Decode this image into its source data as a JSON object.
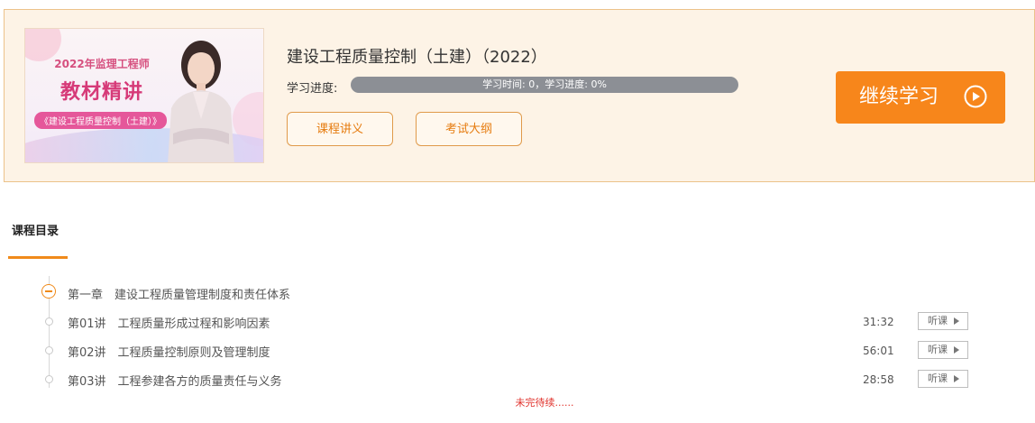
{
  "course": {
    "title": "建设工程质量控制（土建）（2022）",
    "thumbnail": {
      "line1": "2022年监理工程师",
      "line2": "教材精讲",
      "line3": "《建设工程质量控制（土建）》"
    },
    "progress_label": "学习进度:",
    "progress_text": "学习时间: 0，学习进度: 0%",
    "progress_percent": 0,
    "buttons": {
      "lecture_notes": "课程讲义",
      "exam_outline": "考试大纲",
      "continue": "继续学习"
    }
  },
  "catalog": {
    "title": "课程目录",
    "chapters": [
      {
        "label": "第一章　建设工程质量管理制度和责任体系",
        "lessons": [
          {
            "title": "第01讲　工程质量形成过程和影响因素",
            "duration": "31:32",
            "action": "听课"
          },
          {
            "title": "第02讲　工程质量控制原则及管理制度",
            "duration": "56:01",
            "action": "听课"
          },
          {
            "title": "第03讲　工程参建各方的质量责任与义务",
            "duration": "28:58",
            "action": "听课"
          }
        ]
      }
    ],
    "pending": "未完待续......"
  },
  "colors": {
    "accent": "#f7861b",
    "hero_background": "#fdf3e6",
    "progress_track": "#8c8f95",
    "pending_text": "#e0302a"
  }
}
